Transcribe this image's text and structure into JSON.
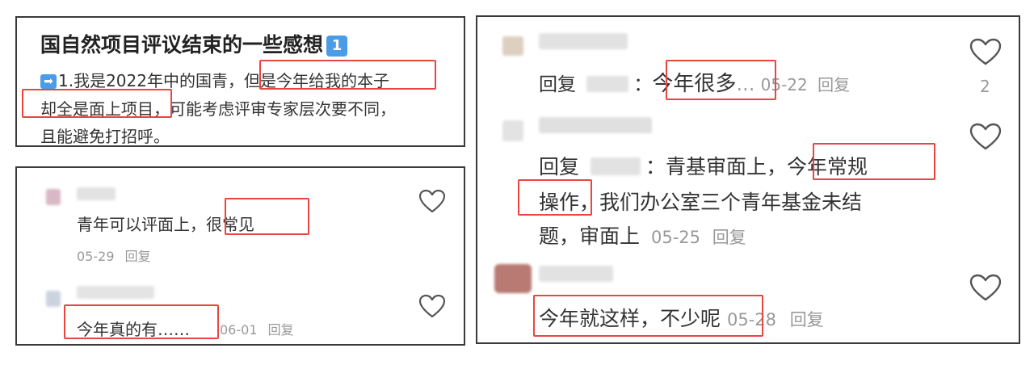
{
  "post": {
    "title": "国自然项目评议结束的一些感想",
    "title_badge": "1",
    "body_prefix_icon": "➡",
    "body_line1_a": "1.我是2022年中的国青，",
    "body_line1_hl": "但是今年给我的本子",
    "body_line2_hl": "却全是面上项目",
    "body_line2_b": "，可能考虑评审专家层次要不同，",
    "body_line3": "且能避免打招呼。"
  },
  "left_comments": [
    {
      "text_a": "青年可以评面上，",
      "text_hl": "很常见",
      "date": "05-29",
      "reply": "回复"
    },
    {
      "text_hl": "今年真的有……",
      "date": "06-01",
      "reply": "回复"
    }
  ],
  "right_comments": [
    {
      "reply_prefix": "回复",
      "colon": "：",
      "text_hl": "今年很多",
      "ellipsis": "…",
      "date": "05-22",
      "reply": "回复",
      "likes": "2"
    },
    {
      "reply_prefix": "回复",
      "colon": "：",
      "text_a": "青基审面上，",
      "text_hl1": "今年常规",
      "text_hl2": "操作",
      "text_b": "，我们办公室三个青年基金未结",
      "text_c": "题，审面上",
      "date": "05-25",
      "reply": "回复"
    },
    {
      "text_hl": "今年就这样，不少呢",
      "date": "05-28",
      "reply": "回复"
    }
  ],
  "colors": {
    "highlight": "#e8463f",
    "border": "#3a3a3a",
    "accent_icon": "#4a9be8"
  },
  "icons": [
    "heart-icon",
    "arrow-right-icon",
    "keycap-one-icon"
  ]
}
